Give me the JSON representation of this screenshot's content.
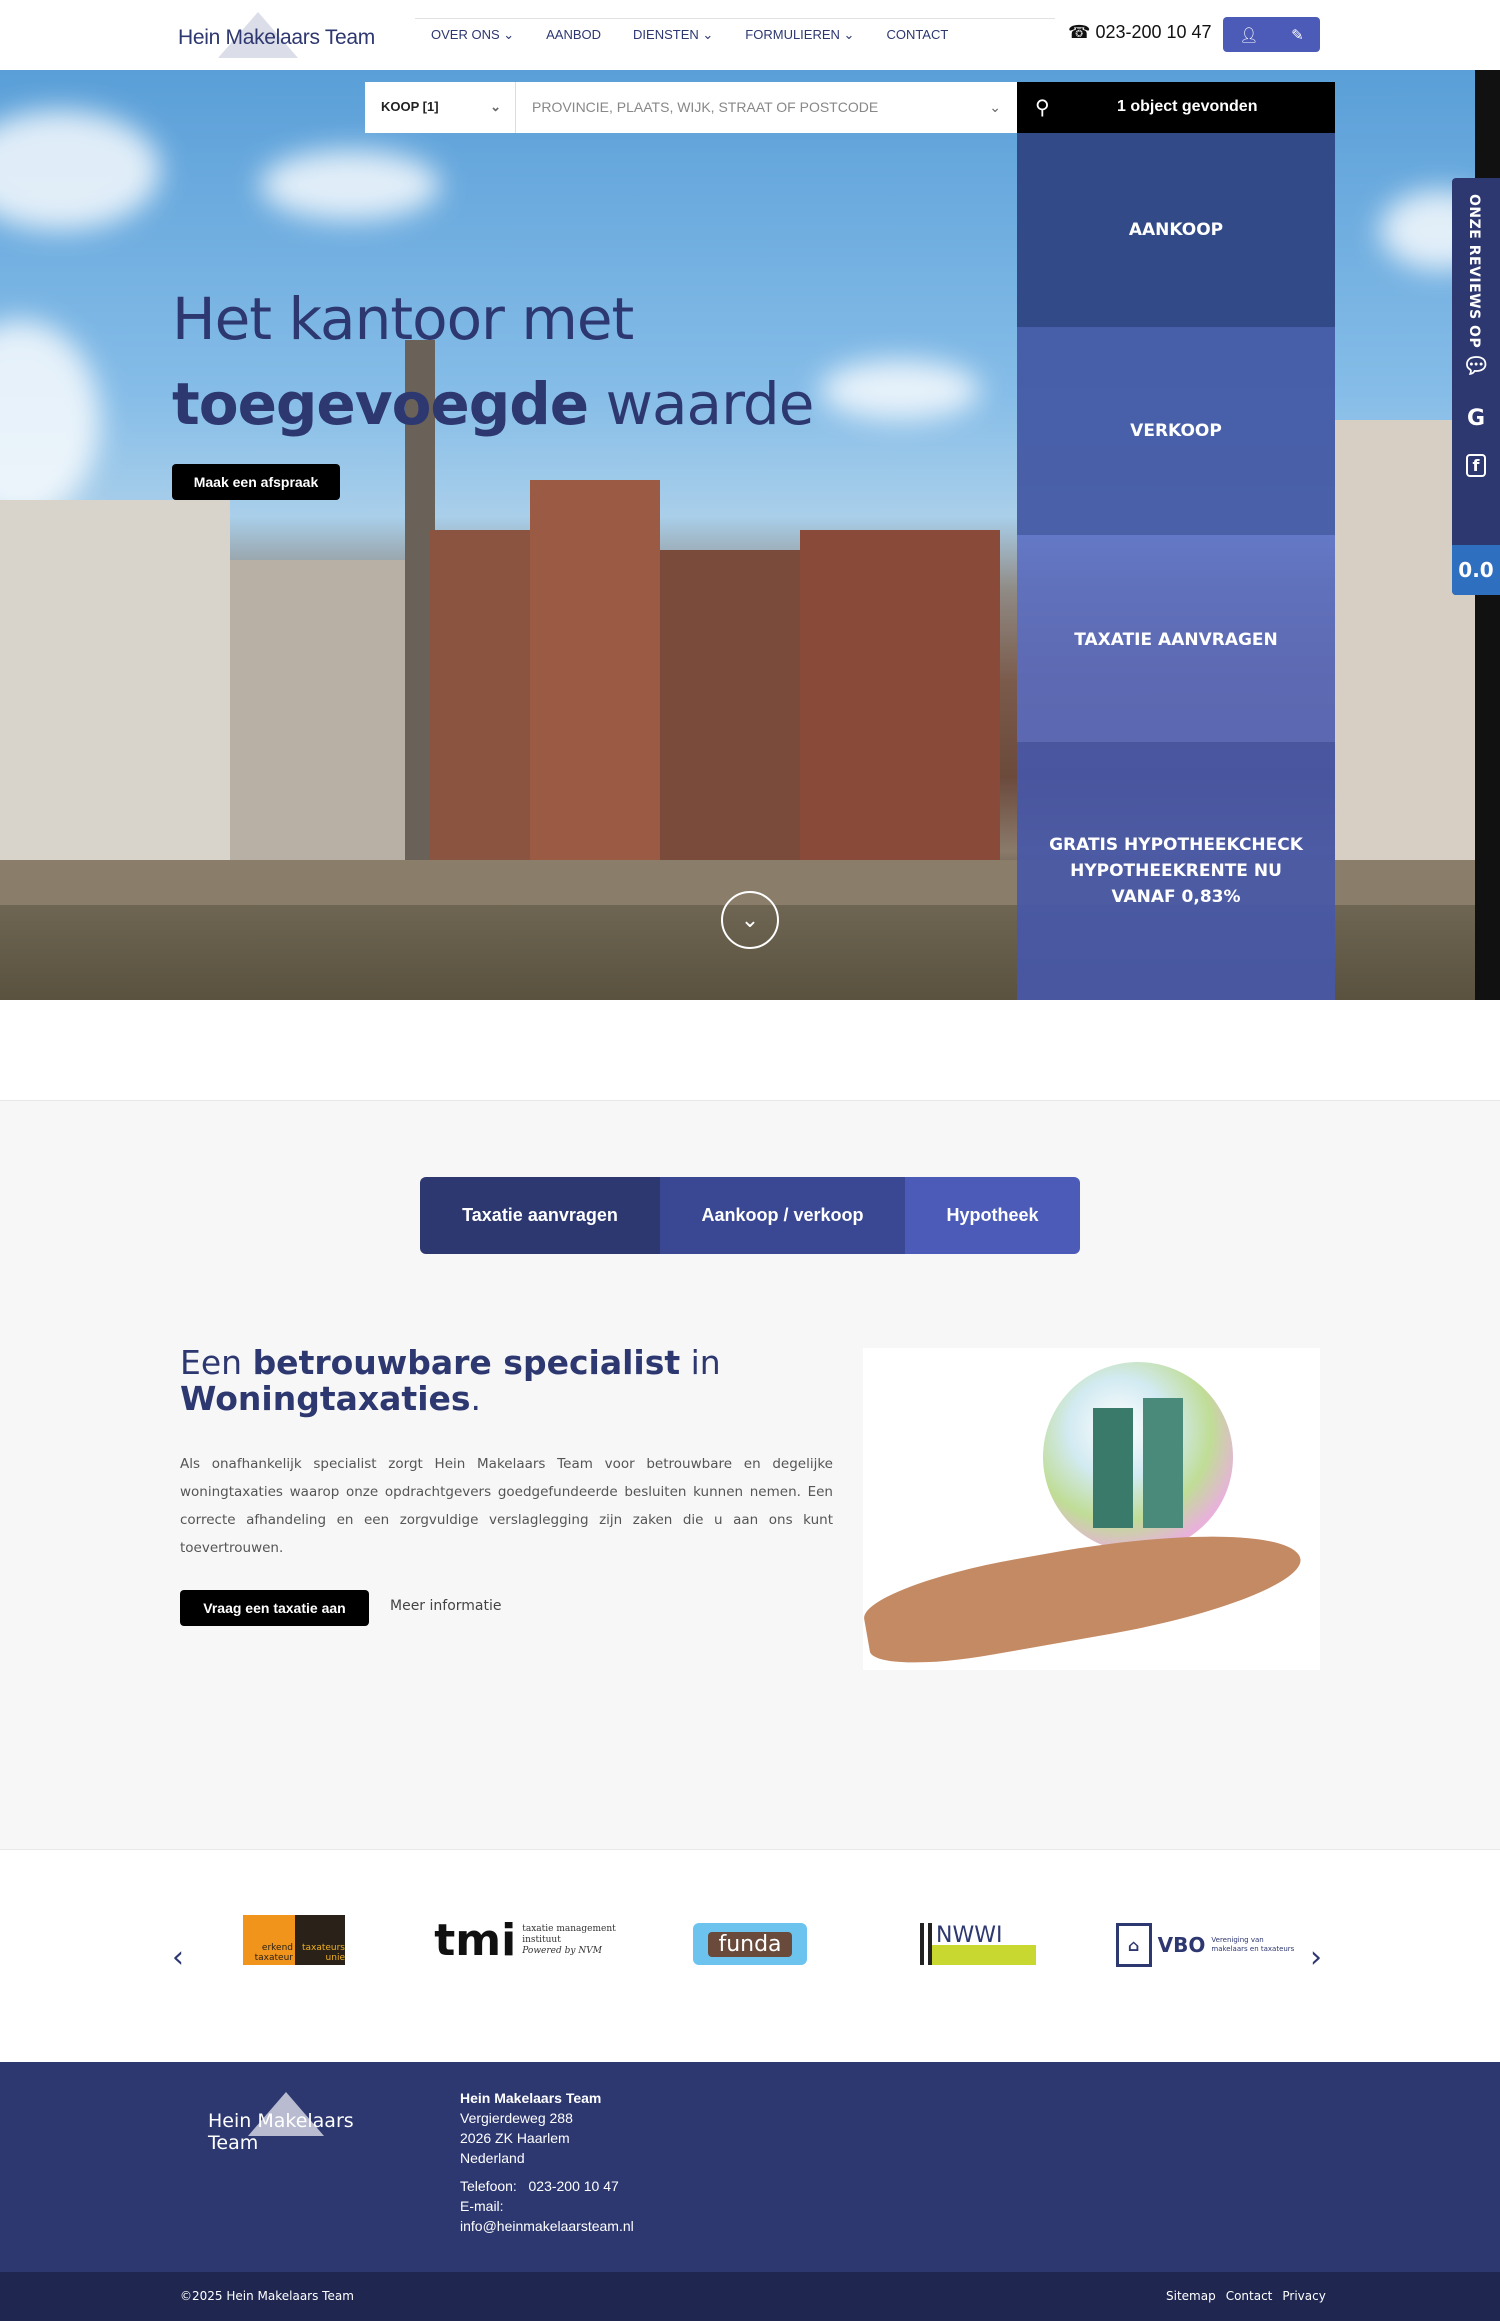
{
  "header": {
    "logo": "Hein Makelaars Team",
    "nav": [
      {
        "label": "OVER ONS",
        "dropdown": true
      },
      {
        "label": "AANBOD",
        "dropdown": false
      },
      {
        "label": "DIENSTEN",
        "dropdown": true
      },
      {
        "label": "FORMULIEREN",
        "dropdown": true
      },
      {
        "label": "CONTACT",
        "dropdown": false
      }
    ],
    "phone": "023-200 10 47",
    "icons": [
      "user-icon",
      "pencil-icon"
    ]
  },
  "search": {
    "type_value": "KOOP [1]",
    "location_placeholder": "PROVINCIE, PLAATS, WIJK, STRAAT OF POSTCODE",
    "result": "1 object gevonden"
  },
  "hero": {
    "line1": "Het kantoor met",
    "line2_bold": "toegevoegde",
    "line2_rest": "waarde",
    "cta": "Maak een afspraak"
  },
  "tiles": [
    "AANKOOP",
    "VERKOOP",
    "TAXATIE AANVRAGEN",
    "GRATIS HYPOTHEEKCHECK HYPOTHEEKRENTE NU VANAF 0,83%"
  ],
  "reviews": {
    "label": "ONZE REVIEWS OP",
    "score": "0.0"
  },
  "tabs": [
    "Taxatie aanvragen",
    "Aankoop / verkoop",
    "Hypotheek"
  ],
  "content": {
    "h_pre": "Een ",
    "h_bold": "betrouwbare specialist",
    "h_mid": " in",
    "h_bold2": "Woningtaxaties",
    "h_end": ".",
    "paragraph": "Als onafhankelijk specialist zorgt Hein Makelaars Team voor betrouwbare en degelijke woningtaxaties waarop onze opdrachtgevers goedgefundeerde besluiten kunnen nemen. Een correcte afhandeling en een zorgvuldige verslaglegging zijn zaken die u aan ons kunt toevertrouwen.",
    "cta": "Vraag een taxatie aan",
    "more": "Meer informatie"
  },
  "partners": {
    "tu": [
      "erkend taxateur",
      "taxateurs unie"
    ],
    "tmi": "tmi",
    "tmi_sub": [
      "taxatie management",
      "instituut",
      "Powered by NVM"
    ],
    "funda": "funda",
    "nwwi": "NWWI",
    "vbo": "VBO",
    "vbo_sub": [
      "Vereniging van",
      "makelaars en taxateurs"
    ]
  },
  "footer": {
    "logo": "Hein Makelaars Team",
    "name": "Hein Makelaars Team",
    "street": "Vergierdeweg 288",
    "city": "2026 ZK Haarlem",
    "country": "Nederland",
    "phone_label": "Telefoon:",
    "phone": "023-200 10 47",
    "email_label": "E-mail:",
    "email": "info@heinmakelaarsteam.nl",
    "copyright": "©2025 Hein Makelaars Team",
    "links": [
      "Sitemap",
      "Contact",
      "Privacy"
    ]
  },
  "colors": {
    "primary": "#2d3770",
    "accent": "#4c5bb8",
    "score": "#2f6fc0"
  }
}
